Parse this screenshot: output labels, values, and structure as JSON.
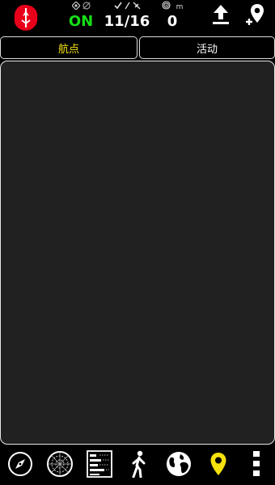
{
  "status": {
    "gps_value": "ON",
    "satellites_value": "11/16",
    "distance_unit": "m",
    "distance_value": "0"
  },
  "tabs": [
    {
      "label": "航点",
      "active": true
    },
    {
      "label": "活动",
      "active": false
    }
  ],
  "icons": {
    "logo": "app-logo",
    "gps_status": "gps-target-icon",
    "gps_alt": "gps-off-icon",
    "sats_fixed": "check-icon",
    "sats_separator": "slash-icon",
    "sats_visible": "satellite-icon",
    "distance": "spiral-icon",
    "upload": "upload-icon",
    "add_waypoint": "add-waypoint-icon",
    "nav": [
      "compass-icon",
      "radar-icon",
      "stats-list-icon",
      "walking-icon",
      "globe-icon",
      "map-pin-icon",
      "more-vertical-icon"
    ]
  },
  "colors": {
    "background": "#000000",
    "panel": "#212121",
    "active_tab_text": "#f5e10c",
    "gps_on": "#16e016",
    "active_nav": "#f5e10c",
    "logo": "#e8001a"
  }
}
